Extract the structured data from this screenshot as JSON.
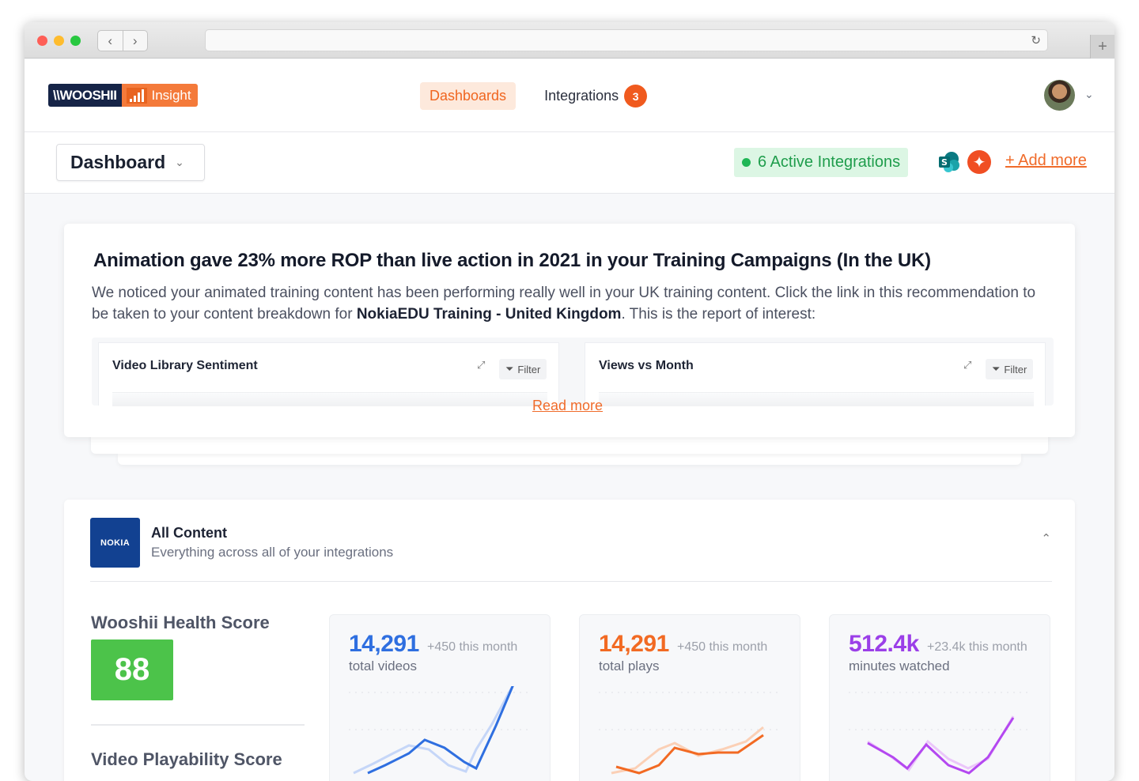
{
  "app": {
    "logo_left": "\\\\WOOSHII",
    "logo_right": "Insight",
    "nav": {
      "dashboards": "Dashboards",
      "integrations": "Integrations",
      "integrations_count": "3"
    }
  },
  "subheader": {
    "dashboard_select": "Dashboard",
    "active_integrations": "6 Active Integrations",
    "add_more": "+ Add more"
  },
  "recommendation": {
    "title": "Animation gave 23% more ROP than live action in 2021 in your Training Campaigns (In the UK)",
    "body_1": "We noticed your animated training content has been performing really well in your UK training content. Click the link in this recommendation to be taken to your content breakdown for ",
    "body_bold": "NokiaEDU Training - United Kingdom",
    "body_2": ". This is the report of interest:",
    "widgets": [
      {
        "title": "Video Library Sentiment",
        "filter": "Filter"
      },
      {
        "title": "Views vs Month",
        "filter": "Filter"
      }
    ],
    "read_more": "Read more"
  },
  "all_content": {
    "brand": "NOKIA",
    "title": "All Content",
    "subtitle": "Everything across all of your integrations",
    "health_label": "Wooshii Health Score",
    "health_score": "88",
    "playability_label": "Video Playability Score",
    "stats": [
      {
        "value": "14,291",
        "delta": "+450 this month",
        "label": "total videos",
        "color": "#2f6fe0"
      },
      {
        "value": "14,291",
        "delta": "+450 this month",
        "label": "total plays",
        "color": "#f26a23"
      },
      {
        "value": "512.4k",
        "delta": "+23.4k this month",
        "label": "minutes watched",
        "color": "#9b3fe8"
      }
    ]
  },
  "colors": {
    "accent": "#f06b2a",
    "success": "#1fb655",
    "nokia": "#124191"
  }
}
